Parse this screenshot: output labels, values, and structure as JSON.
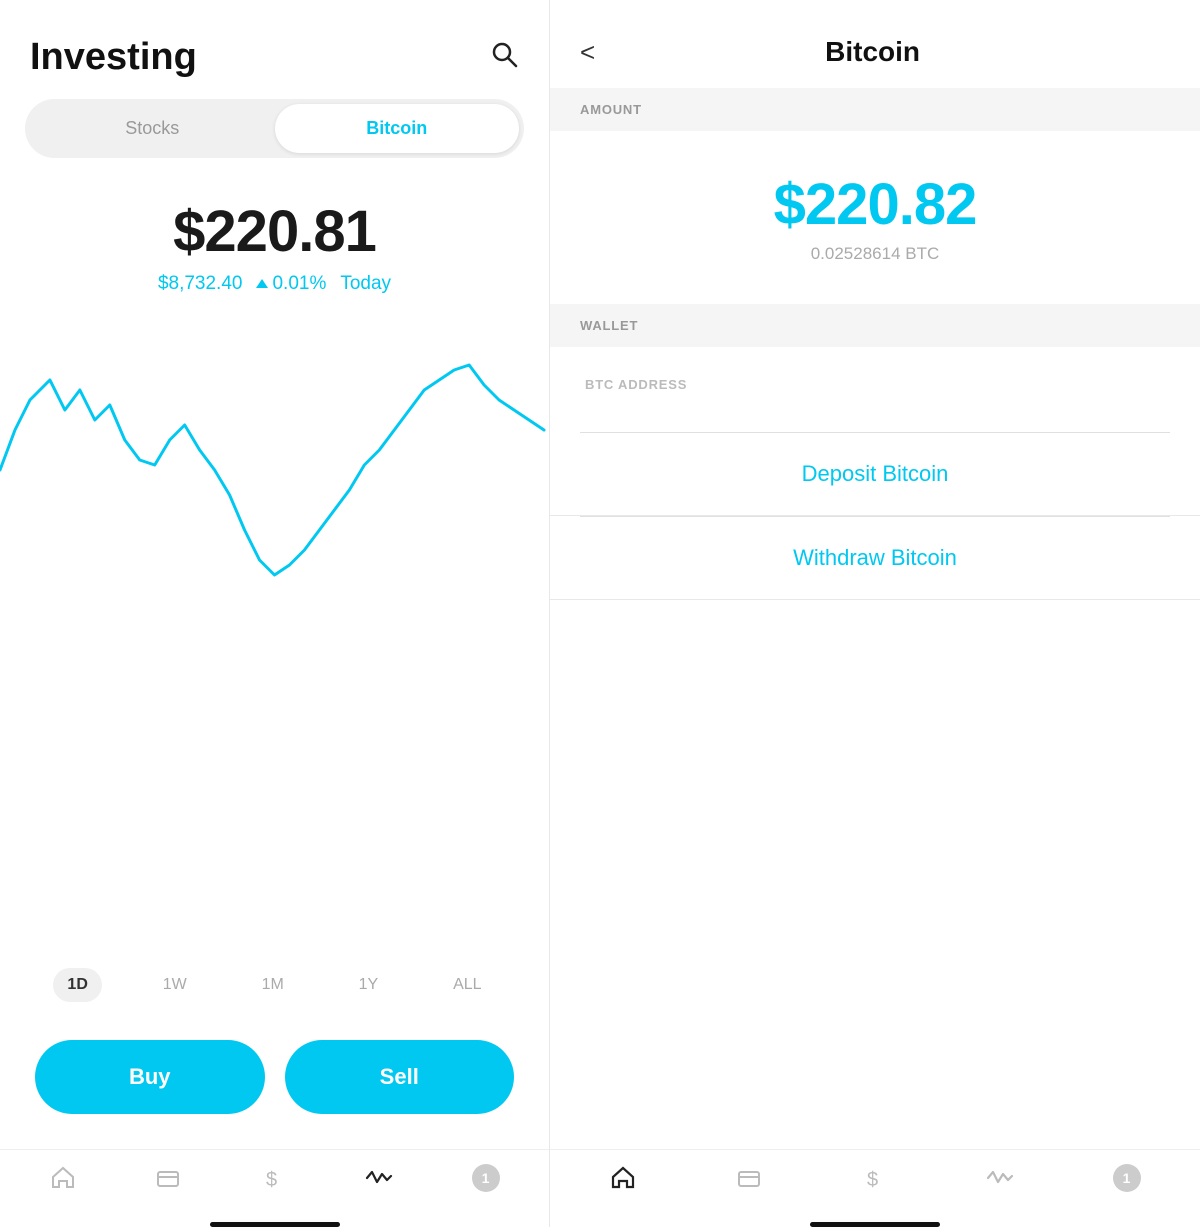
{
  "left": {
    "title": "Investing",
    "tabs": [
      {
        "label": "Stocks",
        "active": false
      },
      {
        "label": "Bitcoin",
        "active": true
      }
    ],
    "portfolio": {
      "amount": "$220.81",
      "price": "$8,732.40",
      "change": "0.01%",
      "period": "Today"
    },
    "timeRanges": [
      {
        "label": "1D",
        "active": true
      },
      {
        "label": "1W",
        "active": false
      },
      {
        "label": "1M",
        "active": false
      },
      {
        "label": "1Y",
        "active": false
      },
      {
        "label": "ALL",
        "active": false
      }
    ],
    "buttons": {
      "buy": "Buy",
      "sell": "Sell"
    },
    "nav": {
      "items": [
        "home",
        "card",
        "dollar",
        "activity",
        "notification"
      ]
    }
  },
  "right": {
    "back_label": "<",
    "title": "Bitcoin",
    "sections": {
      "amount_label": "AMOUNT",
      "wallet_label": "WALLET",
      "btc_address_label": "BTC ADDRESS",
      "amount_usd": "$220.82",
      "amount_btc": "0.02528614 BTC"
    },
    "actions": {
      "deposit": "Deposit Bitcoin",
      "withdraw": "Withdraw Bitcoin"
    },
    "nav": {
      "items": [
        "home",
        "card",
        "dollar",
        "activity",
        "notification"
      ]
    }
  }
}
